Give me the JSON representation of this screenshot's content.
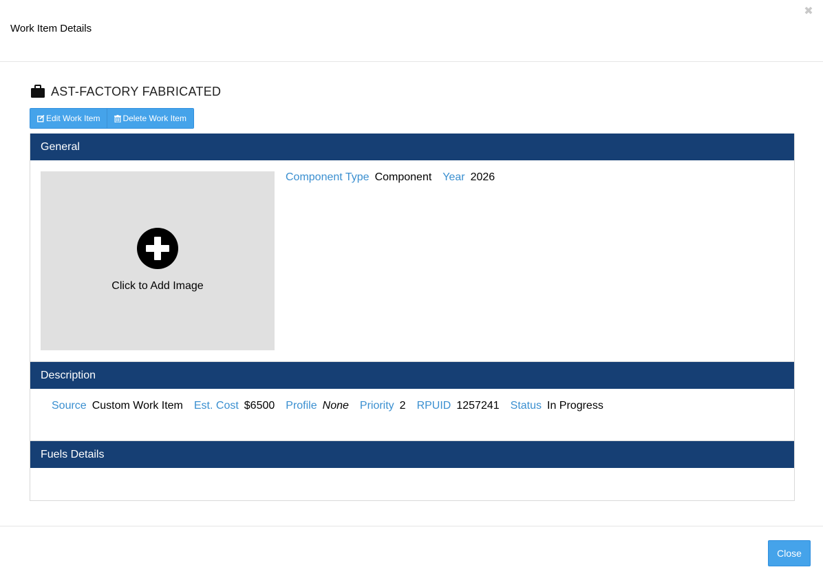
{
  "modal": {
    "title": "Work Item Details",
    "close_icon": "times-icon"
  },
  "item": {
    "icon": "briefcase-icon",
    "title": "AST-FACTORY FABRICATED"
  },
  "toolbar": {
    "edit_label": "Edit Work Item",
    "edit_icon": "edit-icon",
    "delete_label": "Delete Work Item",
    "delete_icon": "trash-icon"
  },
  "general": {
    "heading": "General",
    "image_placeholder": "Click to Add Image",
    "image_icon": "plus-circle-icon",
    "component_type_label": "Component Type",
    "component_type_value": "Component",
    "year_label": "Year",
    "year_value": "2026"
  },
  "description": {
    "heading": "Description",
    "source_label": "Source",
    "source_value": "Custom Work Item",
    "cost_label": "Est. Cost",
    "cost_value": "$6500",
    "profile_label": "Profile",
    "profile_value": "None",
    "priority_label": "Priority",
    "priority_value": "2",
    "rpuid_label": "RPUID",
    "rpuid_value": "1257241",
    "status_label": "Status",
    "status_value": "In Progress"
  },
  "fuels": {
    "heading": "Fuels Details"
  },
  "footer": {
    "close_label": "Close"
  },
  "colors": {
    "panel_header": "#163f74",
    "button": "#45a3ea",
    "label_blue": "#3a8fd0",
    "image_bg": "#e0e0e0"
  }
}
